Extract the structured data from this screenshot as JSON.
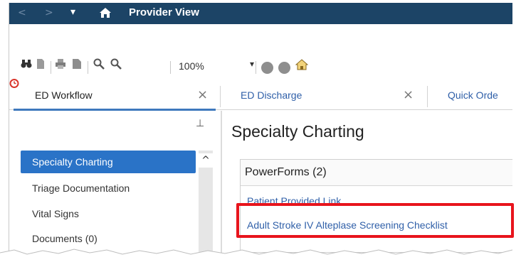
{
  "titlebar": {
    "title": "Provider View",
    "back_glyph": "<",
    "forward_glyph": ">",
    "dropdown_glyph": "▾",
    "home_icon": "home-icon"
  },
  "toolbar": {
    "zoom": "100%",
    "zoom_caret": "▾",
    "icons": [
      "binoculars-icon",
      "page-icon",
      "print-icon",
      "print-preview-icon",
      "zoom-in-icon",
      "zoom-out-icon",
      "circle-icon",
      "circle-icon",
      "house-icon",
      "alarm-clock-icon"
    ]
  },
  "tabs": [
    {
      "label": "ED Workflow",
      "close": "×",
      "active": true
    },
    {
      "label": "ED Discharge",
      "close": "×",
      "active": false
    },
    {
      "label": "Quick Orde",
      "active": false
    }
  ],
  "leftnav": {
    "pin_glyph": "⊥",
    "scroll_up": "^",
    "items": [
      {
        "label": "Specialty Charting",
        "active": true
      },
      {
        "label": "Triage Documentation",
        "active": false
      },
      {
        "label": "Vital Signs",
        "active": false
      },
      {
        "label": "Documents (0)",
        "active": false
      }
    ]
  },
  "main": {
    "heading": "Specialty Charting",
    "powerforms_title": "PowerForms (2)",
    "links": [
      "Patient Provided Link",
      "Adult Stroke IV Alteplase Screening Checklist"
    ]
  },
  "colors": {
    "titlebar_bg": "#1c4466",
    "active_nav": "#2a73c7",
    "link": "#2f5fa8",
    "highlight": "#e8141c",
    "tab_underline": "#3f79bd"
  }
}
